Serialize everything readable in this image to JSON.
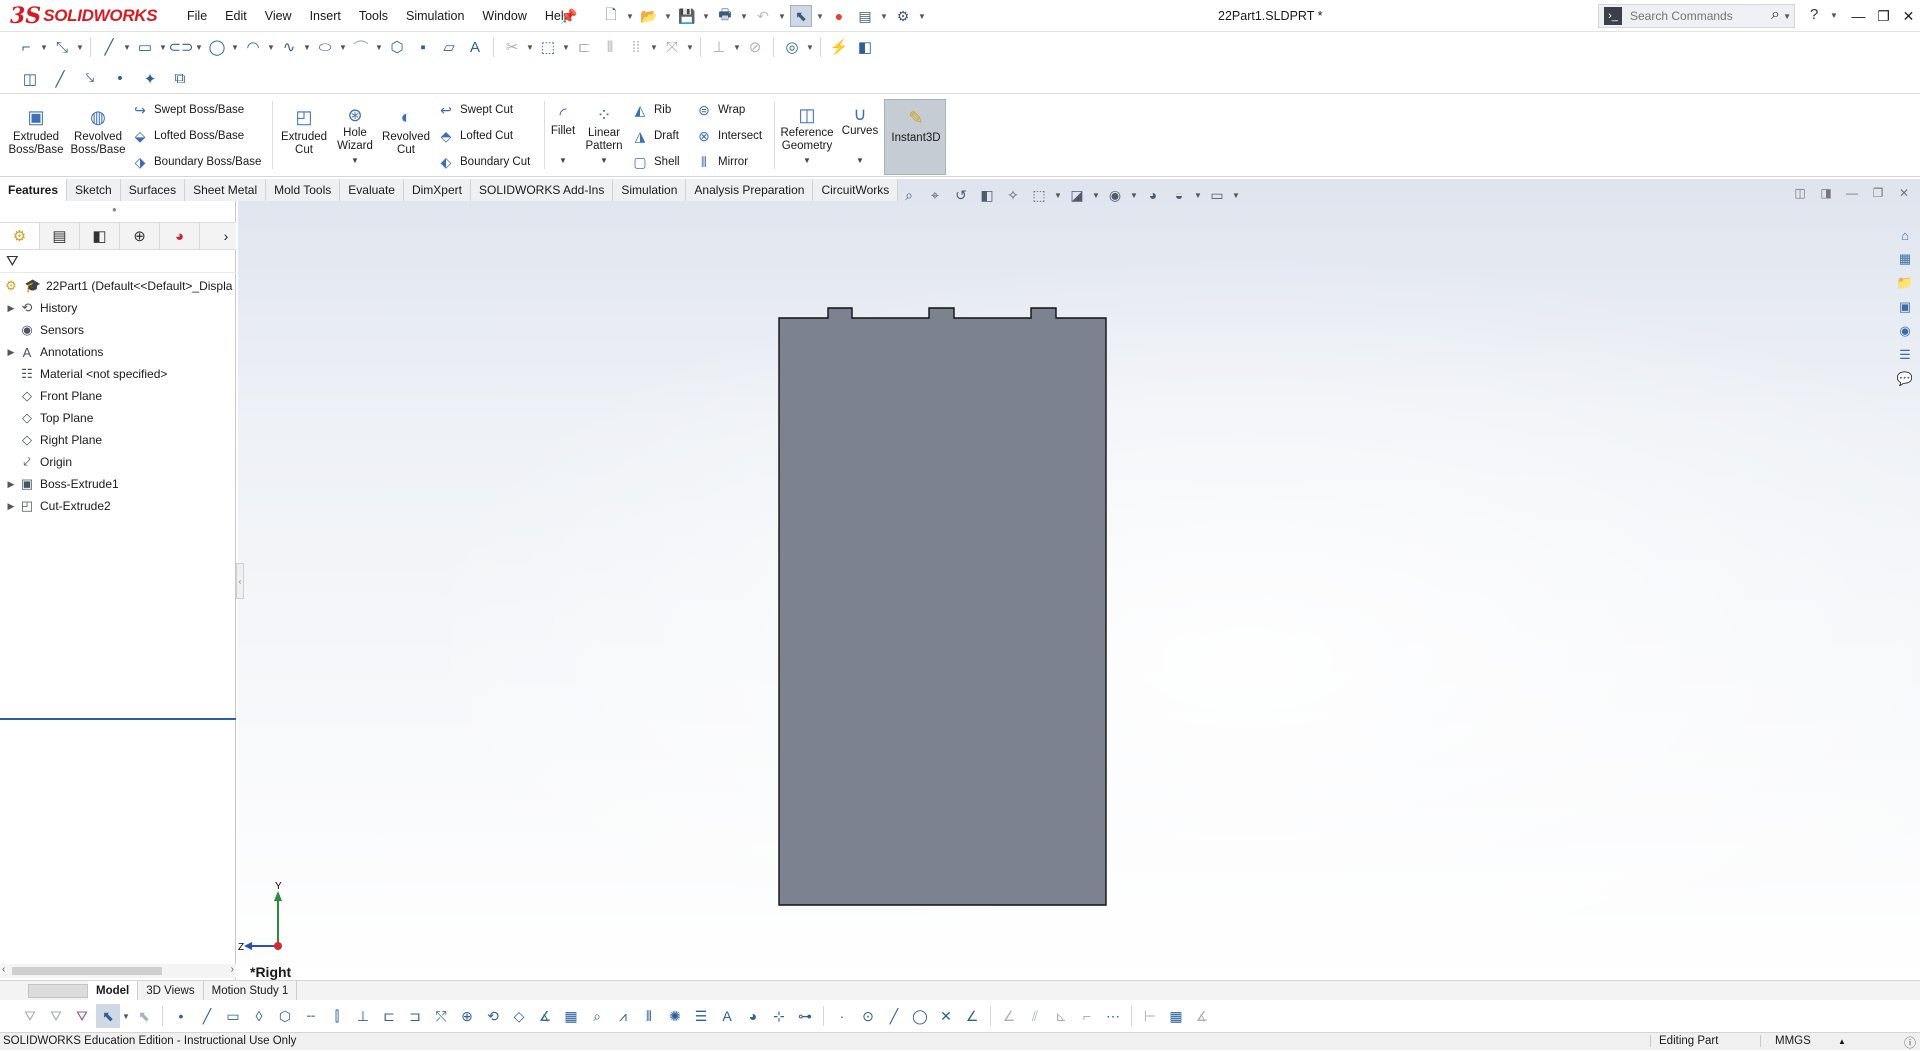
{
  "app": {
    "logo_ds": "3S",
    "logo_text": "SOLIDWORKS",
    "document_title": "22Part1.SLDPRT *"
  },
  "menu": [
    "File",
    "Edit",
    "View",
    "Insert",
    "Tools",
    "Simulation",
    "Window",
    "Help"
  ],
  "search": {
    "placeholder": "Search Commands"
  },
  "command_manager": {
    "extruded_boss": "Extruded Boss/Base",
    "revolved_boss": "Revolved Boss/Base",
    "swept_boss": "Swept Boss/Base",
    "lofted_boss": "Lofted Boss/Base",
    "boundary_boss": "Boundary Boss/Base",
    "extruded_cut": "Extruded Cut",
    "hole_wizard": "Hole Wizard",
    "revolved_cut": "Revolved Cut",
    "swept_cut": "Swept Cut",
    "lofted_cut": "Lofted Cut",
    "boundary_cut": "Boundary Cut",
    "fillet": "Fillet",
    "linear_pattern": "Linear Pattern",
    "rib": "Rib",
    "draft": "Draft",
    "shell": "Shell",
    "wrap": "Wrap",
    "intersect": "Intersect",
    "mirror": "Mirror",
    "reference_geometry": "Reference Geometry",
    "curves": "Curves",
    "instant3d": "Instant3D"
  },
  "tabs": [
    "Features",
    "Sketch",
    "Surfaces",
    "Sheet Metal",
    "Mold Tools",
    "Evaluate",
    "DimXpert",
    "SOLIDWORKS Add-Ins",
    "Simulation",
    "Analysis Preparation",
    "CircuitWorks"
  ],
  "feature_tree": {
    "root": "22Part1  (Default<<Default>_Displa",
    "items": [
      {
        "label": "History",
        "icon": "history-icon",
        "expandable": true
      },
      {
        "label": "Sensors",
        "icon": "sensor-icon",
        "expandable": false
      },
      {
        "label": "Annotations",
        "icon": "annotations-icon",
        "expandable": true
      },
      {
        "label": "Material <not specified>",
        "icon": "material-icon",
        "expandable": false
      },
      {
        "label": "Front Plane",
        "icon": "plane-icon",
        "expandable": false
      },
      {
        "label": "Top Plane",
        "icon": "plane-icon",
        "expandable": false
      },
      {
        "label": "Right Plane",
        "icon": "plane-icon",
        "expandable": false
      },
      {
        "label": "Origin",
        "icon": "origin-icon",
        "expandable": false
      },
      {
        "label": "Boss-Extrude1",
        "icon": "boss-extrude-icon",
        "expandable": true
      },
      {
        "label": "Cut-Extrude2",
        "icon": "cut-extrude-icon",
        "expandable": true
      }
    ]
  },
  "viewport": {
    "view_name": "*Right",
    "triad_y": "Y",
    "triad_z": "Z",
    "part_color": "#7d8290"
  },
  "bottom_tabs": [
    "Model",
    "3D Views",
    "Motion Study 1"
  ],
  "status": {
    "left": "SOLIDWORKS Education Edition - Instructional Use Only",
    "mode": "Editing Part",
    "units": "MMGS"
  }
}
